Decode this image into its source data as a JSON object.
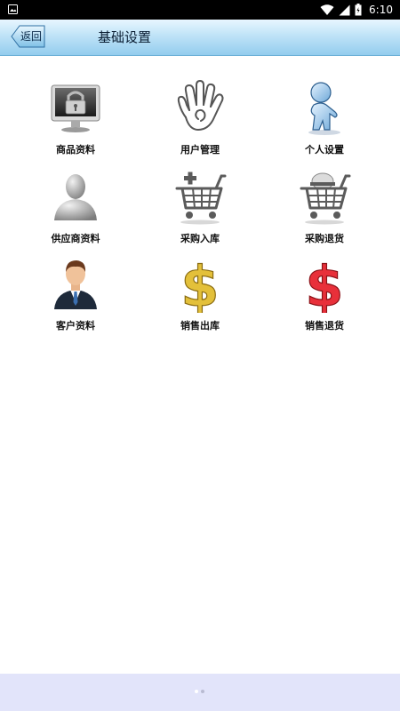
{
  "status_bar": {
    "time": "6:10",
    "icons": [
      "image-icon",
      "wifi-icon",
      "signal-icon",
      "battery-icon"
    ]
  },
  "header": {
    "back_label": "返回",
    "title": "基础设置"
  },
  "grid": {
    "items": [
      {
        "label": "商品资料",
        "icon": "monitor-lock-icon"
      },
      {
        "label": "用户管理",
        "icon": "hand-icon"
      },
      {
        "label": "个人设置",
        "icon": "person-icon"
      },
      {
        "label": "供应商资料",
        "icon": "user-silhouette-icon"
      },
      {
        "label": "采购入库",
        "icon": "cart-add-icon"
      },
      {
        "label": "采购退货",
        "icon": "cart-return-icon"
      },
      {
        "label": "客户资料",
        "icon": "businessman-icon"
      },
      {
        "label": "销售出库",
        "icon": "gold-dollar-icon"
      },
      {
        "label": "销售退货",
        "icon": "red-dollar-icon"
      }
    ]
  },
  "colors": {
    "header_gradient_top": "#e8f6ff",
    "header_gradient_bottom": "#93cdee",
    "bottom_bar": "#e2e4fa"
  }
}
